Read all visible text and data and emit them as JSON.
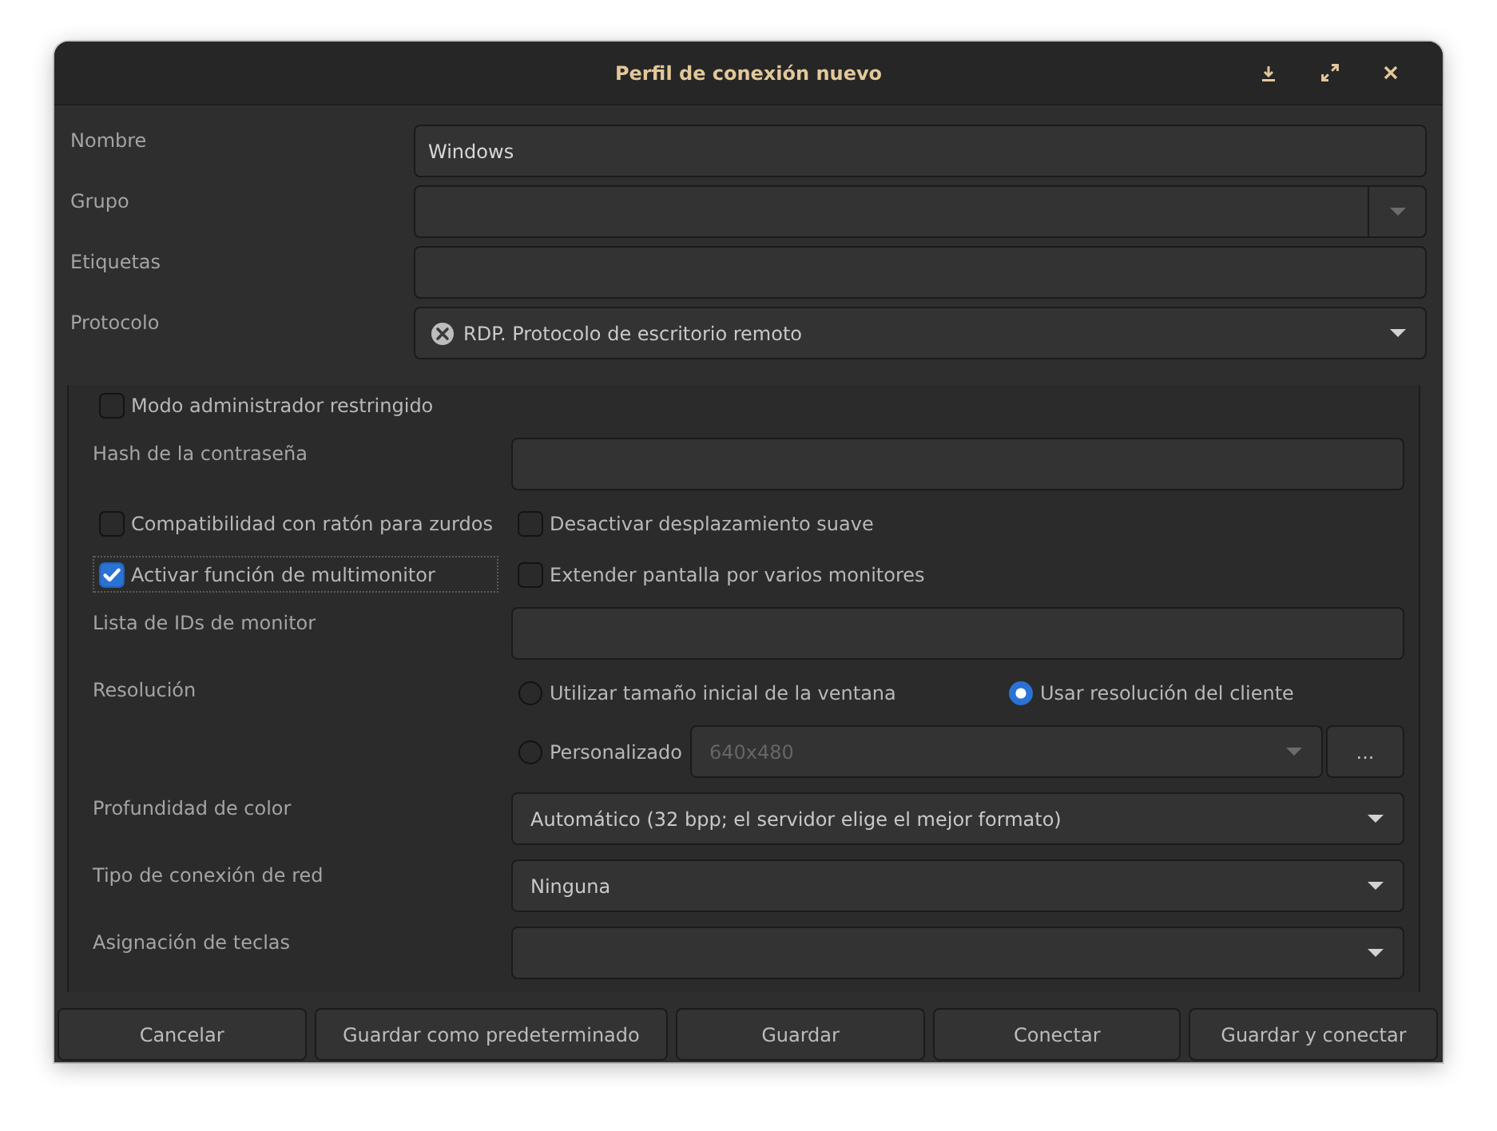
{
  "window": {
    "title": "Perfil de conexión nuevo"
  },
  "general": [
    {
      "kind": "entry",
      "label": "Nombre",
      "value": "Windows"
    },
    {
      "kind": "combo_entry",
      "label": "Grupo"
    },
    {
      "kind": "entry",
      "label": "Etiquetas"
    },
    {
      "kind": "combo",
      "label": "Protocolo",
      "value": "RDP. Protocolo de escritorio remoto",
      "icon": true
    }
  ],
  "settings": [
    {
      "kind": "checks",
      "items": [
        {
          "label": "Modo administrador restringido",
          "checked": false,
          "focused": false
        }
      ]
    },
    {
      "kind": "entry",
      "label": "Hash de la contraseña"
    },
    {
      "kind": "checks",
      "items": [
        {
          "label": "Compatibilidad con ratón para zurdos",
          "checked": false,
          "focused": false
        },
        {
          "label": "Desactivar desplazamiento suave",
          "checked": false,
          "focused": false
        }
      ]
    },
    {
      "kind": "checks",
      "items": [
        {
          "label": "Activar función de multimonitor",
          "checked": true,
          "focused": true
        },
        {
          "label": "Extender pantalla por varios monitores",
          "checked": false,
          "focused": false
        }
      ]
    },
    {
      "kind": "entry",
      "label": "Lista de IDs de monitor"
    },
    {
      "kind": "resolution",
      "label": "Resolución",
      "options": [
        {
          "label": "Utilizar tamaño inicial de la ventana",
          "selected": false
        },
        {
          "label": "Usar resolución del cliente",
          "selected": true
        },
        {
          "label": "Personalizado",
          "selected": false
        }
      ],
      "custom": {
        "value": "640x480",
        "disabled": true
      },
      "button": "..."
    },
    {
      "kind": "combo",
      "label": "Profundidad de color",
      "value": "Automático (32 bpp; el servidor elige el mejor formato)"
    },
    {
      "kind": "combo",
      "label": "Tipo de conexión de red",
      "value": "Ninguna"
    },
    {
      "kind": "combo",
      "label": "Asignación de teclas"
    }
  ],
  "buttons": [
    "Cancelar",
    "Guardar como predeterminado",
    "Guardar",
    "Conectar",
    "Guardar y conectar"
  ]
}
